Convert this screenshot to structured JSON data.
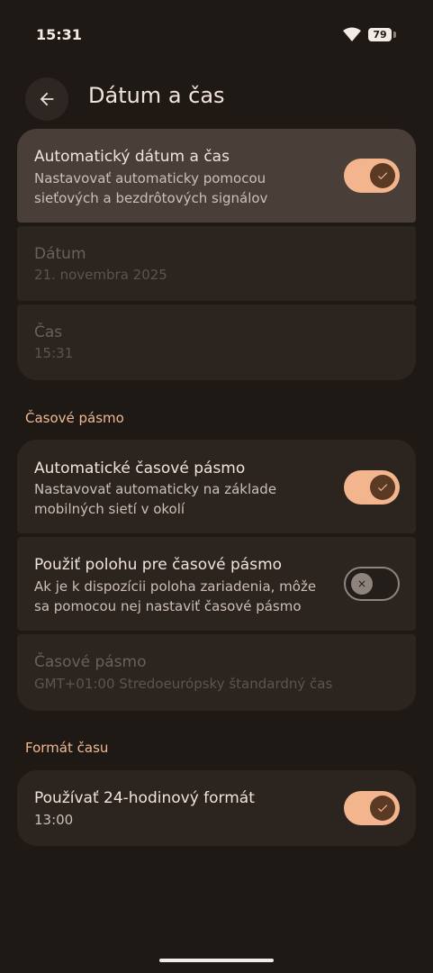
{
  "status": {
    "time": "15:31",
    "battery": "79"
  },
  "header": {
    "title": "Dátum a čas"
  },
  "date_time": {
    "auto": {
      "title": "Automatický dátum a čas",
      "subtitle": "Nastavovať automaticky pomocou sieťových a bezdrôtových signálov",
      "enabled": true
    },
    "date": {
      "title": "Dátum",
      "value": "21. novembra 2025"
    },
    "time": {
      "title": "Čas",
      "value": "15:31"
    }
  },
  "timezone": {
    "heading": "Časové pásmo",
    "auto": {
      "title": "Automatické časové pásmo",
      "subtitle": "Nastavovať automaticky na základe mobilných sietí v okolí",
      "enabled": true
    },
    "location": {
      "title": "Použiť polohu pre časové pásmo",
      "subtitle": "Ak je k dispozícii poloha zariadenia, môže sa pomocou nej nastaviť časové pásmo",
      "enabled": false
    },
    "zone": {
      "title": "Časové pásmo",
      "value": "GMT+01:00 Stredoeurópsky štandardný čas"
    }
  },
  "format": {
    "heading": "Formát času",
    "h24": {
      "title": "Používať 24-hodinový formát",
      "subtitle": "13:00",
      "enabled": true
    }
  },
  "colors": {
    "accent": "#f2b58d",
    "background": "#1f1915",
    "card": "#2b241f"
  }
}
